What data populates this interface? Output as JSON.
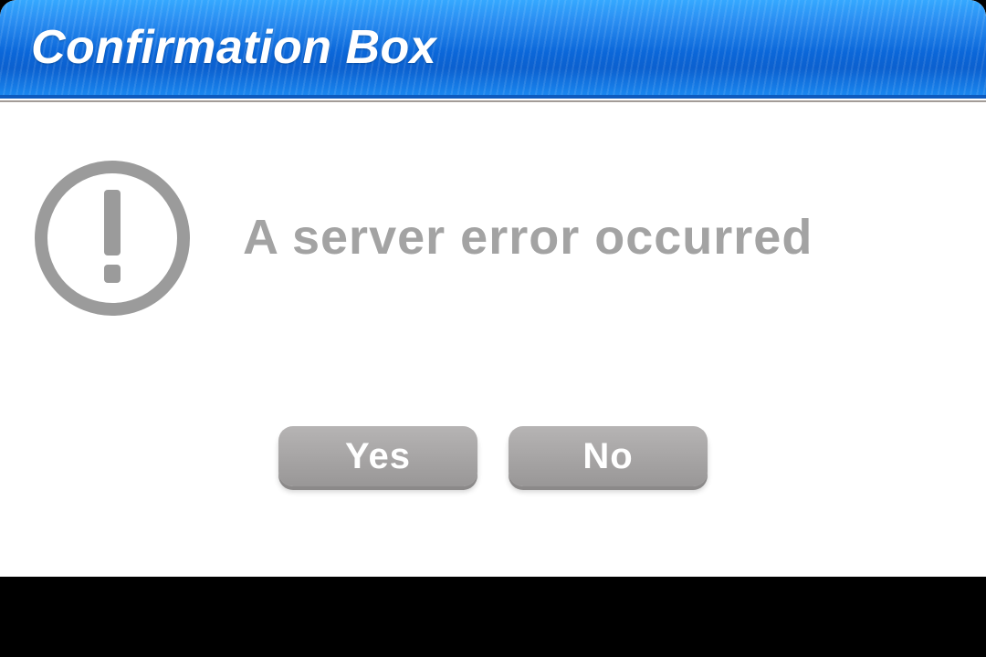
{
  "dialog": {
    "title": "Confirmation Box",
    "message": "A server error occurred",
    "icon": "exclamation-circle-icon",
    "buttons": {
      "yes": "Yes",
      "no": "No"
    },
    "colors": {
      "titlebar_gradient_top": "#35a8ff",
      "titlebar_gradient_bottom": "#1a86ef",
      "message_text": "#a3a3a3",
      "button_bg": "#a6a4a4",
      "button_text": "#ffffff",
      "icon_stroke": "#9b9b9b"
    }
  }
}
